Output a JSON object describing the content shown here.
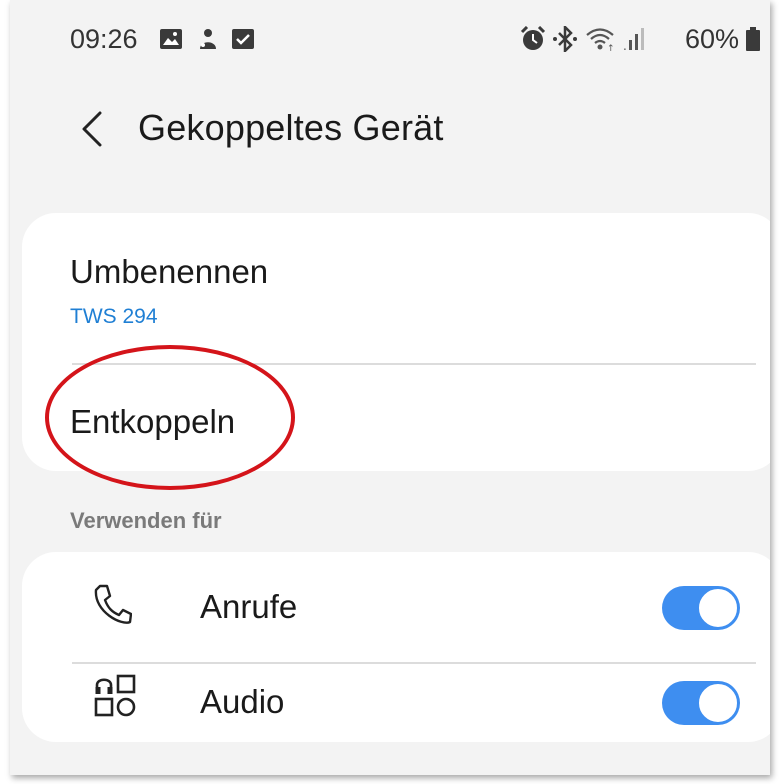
{
  "status_bar": {
    "time": "09:26",
    "battery_percent": "60%",
    "icons": [
      "gallery-icon",
      "app-notification-icon",
      "checkbox-notification-icon",
      "alarm-icon",
      "bluetooth-icon",
      "wifi-icon",
      "signal-icon",
      "battery-icon"
    ]
  },
  "app_bar": {
    "back_icon": "chevron-left-icon",
    "title": "Gekoppeltes Gerät"
  },
  "device_card": {
    "rename": {
      "label": "Umbenennen",
      "device_name": "TWS 294"
    },
    "unpair": {
      "label": "Entkoppeln"
    }
  },
  "use_for": {
    "section_title": "Verwenden für",
    "items": [
      {
        "label": "Anrufe",
        "icon": "phone-icon",
        "enabled": true
      },
      {
        "label": "Audio",
        "icon": "media-audio-icon",
        "enabled": true
      }
    ]
  },
  "colors": {
    "accent": "#3e8ef0",
    "link": "#1f7fd4",
    "annotation": "#d4141a",
    "background": "#f3f3f3"
  }
}
